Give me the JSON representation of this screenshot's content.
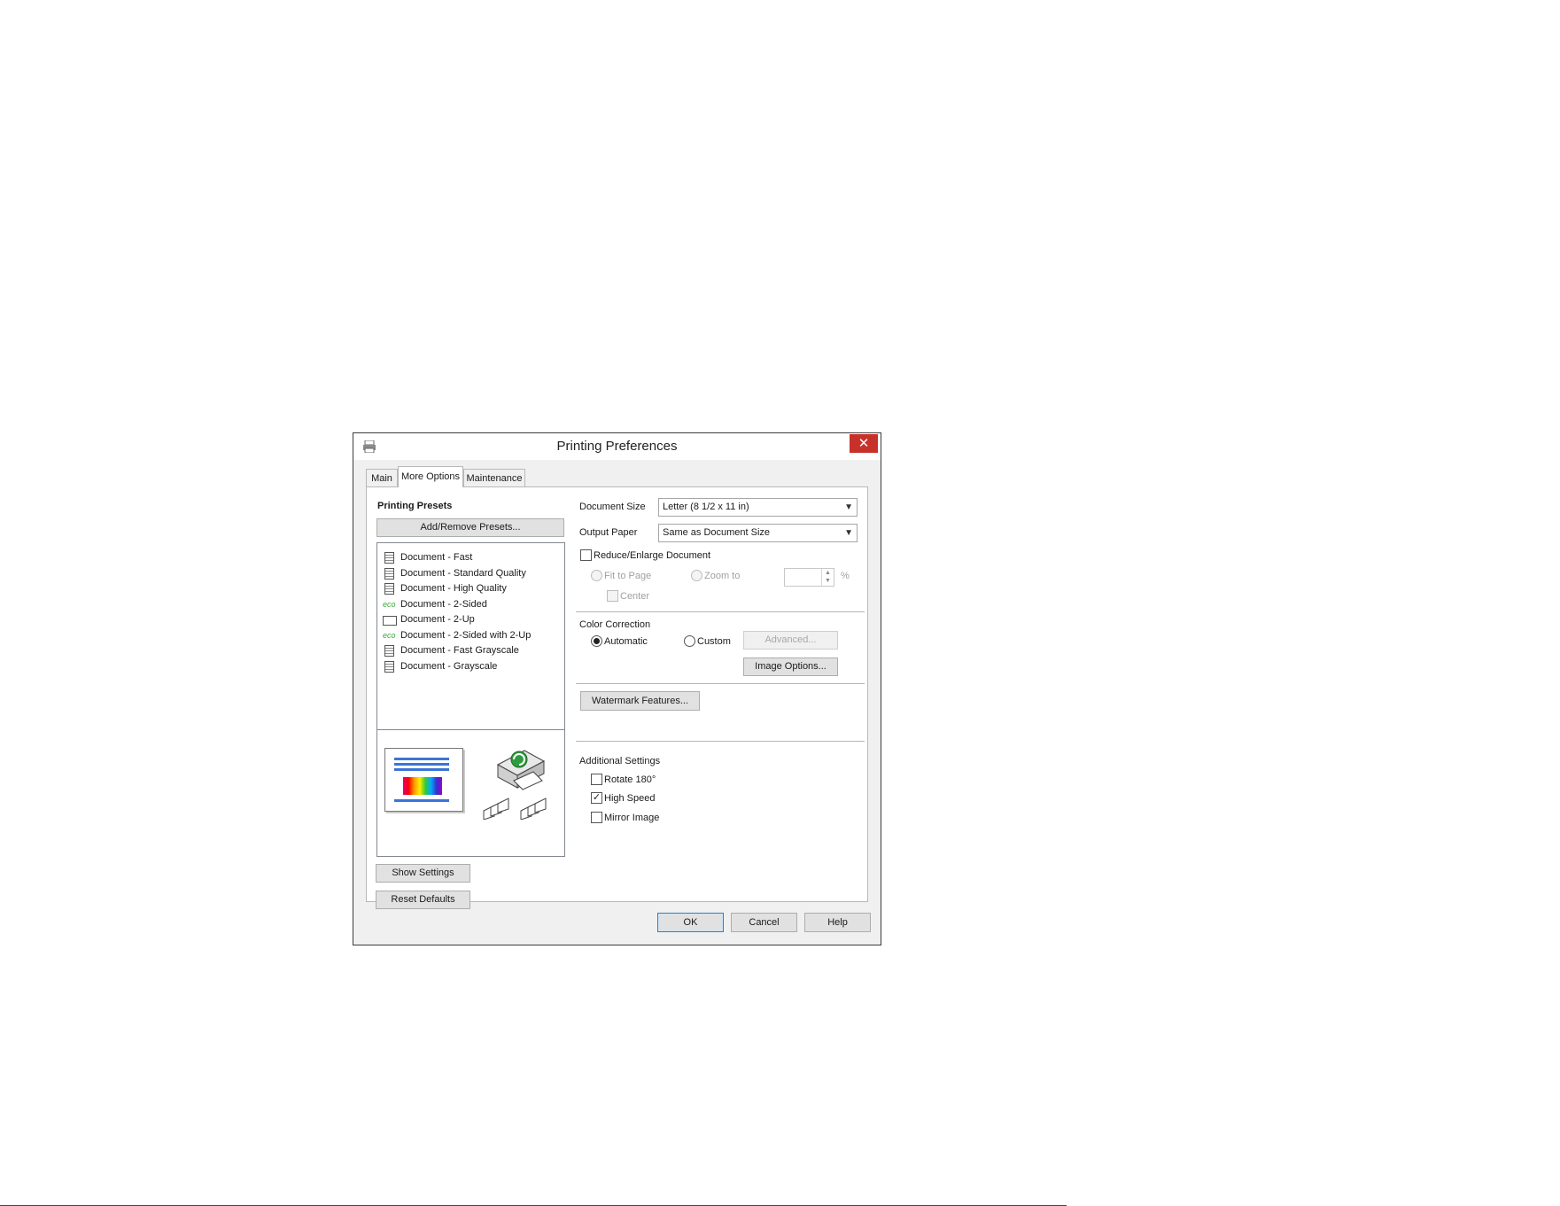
{
  "window": {
    "title": "Printing Preferences",
    "close_glyph": "✕",
    "app_icon": "printer-icon"
  },
  "tabs": [
    {
      "label": "Main",
      "active": false
    },
    {
      "label": "More Options",
      "active": true
    },
    {
      "label": "Maintenance",
      "active": false
    }
  ],
  "presets": {
    "heading": "Printing Presets",
    "add_remove_button": "Add/Remove Presets...",
    "items": [
      {
        "label": "Document - Fast",
        "icon": "document-icon"
      },
      {
        "label": "Document - Standard Quality",
        "icon": "document-icon"
      },
      {
        "label": "Document - High Quality",
        "icon": "document-icon"
      },
      {
        "label": "Document - 2-Sided",
        "icon": "eco-icon"
      },
      {
        "label": "Document - 2-Up",
        "icon": "two-up-icon"
      },
      {
        "label": "Document - 2-Sided with 2-Up",
        "icon": "eco-icon"
      },
      {
        "label": "Document - Fast Grayscale",
        "icon": "document-icon"
      },
      {
        "label": "Document - Grayscale",
        "icon": "document-icon"
      }
    ],
    "eco_text": "eco"
  },
  "document_size": {
    "label": "Document Size",
    "value": "Letter (8 1/2 x 11 in)"
  },
  "output_paper": {
    "label": "Output Paper",
    "value": "Same as Document Size"
  },
  "reduce_enlarge": {
    "label": "Reduce/Enlarge Document",
    "checked": false,
    "fit_to_page": "Fit to Page",
    "zoom_to": "Zoom to",
    "zoom_value": "",
    "percent": "%",
    "center": "Center"
  },
  "color_correction": {
    "heading": "Color Correction",
    "automatic": "Automatic",
    "custom": "Custom",
    "selected": "Automatic",
    "advanced_button": "Advanced...",
    "image_options_button": "Image Options..."
  },
  "watermark_button": "Watermark Features...",
  "additional_settings": {
    "heading": "Additional Settings",
    "rotate": {
      "label": "Rotate 180°",
      "checked": false
    },
    "high_speed": {
      "label": "High Speed",
      "checked": true
    },
    "mirror": {
      "label": "Mirror Image",
      "checked": false
    }
  },
  "left_buttons": {
    "show_settings": "Show Settings",
    "reset_defaults": "Reset Defaults"
  },
  "footer": {
    "ok": "OK",
    "cancel": "Cancel",
    "help": "Help"
  },
  "check_glyph": "✓",
  "colors": {
    "close": "#c7312a",
    "accent_blue": "#3b74d6",
    "eco_green": "#3aa83a"
  }
}
